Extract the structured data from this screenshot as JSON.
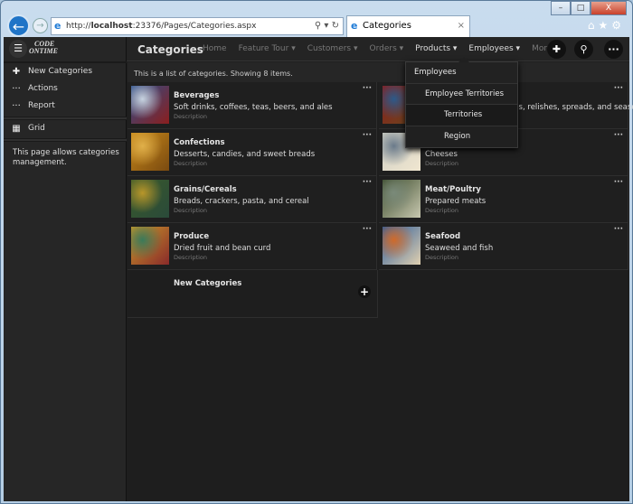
{
  "browser": {
    "url_prefix": "http://",
    "url_host": "localhost",
    "url_rest": ":23376/Pages/Categories.aspx",
    "tab_title": "Categories"
  },
  "sidebar": {
    "logo": "CODE ON TIME",
    "items": [
      {
        "label": "New Categories",
        "icon": "plus-icon"
      },
      {
        "label": "Actions",
        "icon": "more-icon"
      },
      {
        "label": "Report",
        "icon": "more-icon"
      }
    ],
    "view": "Grid",
    "description": "This page allows categories management."
  },
  "header": {
    "title": "Categories",
    "nav": [
      {
        "label": "Home"
      },
      {
        "label": "Feature Tour ▾"
      },
      {
        "label": "Customers ▾"
      },
      {
        "label": "Orders ▾"
      },
      {
        "label": "Products ▾"
      },
      {
        "label": "Employees ▾"
      },
      {
        "label": "More ▾"
      }
    ]
  },
  "info": {
    "text": "This is a list of categories. Showing 8 items."
  },
  "cards": [
    {
      "title": "Beverages",
      "desc": "Soft drinks, coffees, teas, beers, and ales",
      "label": "Description",
      "colors": [
        "#2a4f8a",
        "#c7d3e0",
        "#8b1e1e"
      ]
    },
    {
      "title": "Condiments",
      "desc": "Sweet and savory sauces, relishes, spreads, and seasonings",
      "label": "Description",
      "colors": [
        "#8b1a1a",
        "#2c5a8a",
        "#6a4a20"
      ]
    },
    {
      "title": "Confections",
      "desc": "Desserts, candies, and sweet breads",
      "label": "Description",
      "colors": [
        "#c98a1a",
        "#e0b04a",
        "#7a4a10"
      ]
    },
    {
      "title": "Dairy Products",
      "desc": "Cheeses",
      "label": "Description",
      "colors": [
        "#cfcfc4",
        "#6a7a8a",
        "#f0e6d0"
      ]
    },
    {
      "title": "Grains/Cereals",
      "desc": "Breads, crackers, pasta, and cereal",
      "label": "Description",
      "colors": [
        "#3a5a2a",
        "#b8962a",
        "#2a4a3a"
      ]
    },
    {
      "title": "Meat/Poultry",
      "desc": "Prepared meats",
      "label": "Description",
      "colors": [
        "#3a4a2a",
        "#7a8a7a",
        "#c8c8b0"
      ]
    },
    {
      "title": "Produce",
      "desc": "Dried fruit and bean curd",
      "label": "Description",
      "colors": [
        "#c89a2a",
        "#3a7a5a",
        "#8a2a2a"
      ]
    },
    {
      "title": "Seafood",
      "desc": "Seaweed and fish",
      "label": "Description",
      "colors": [
        "#2a5a9a",
        "#d06a2a",
        "#e0d0b0"
      ]
    }
  ],
  "new_card": {
    "title": "New Categories"
  },
  "dropdown": {
    "items": [
      "Employees",
      "Employee Territories",
      "Territories",
      "Region"
    ]
  }
}
